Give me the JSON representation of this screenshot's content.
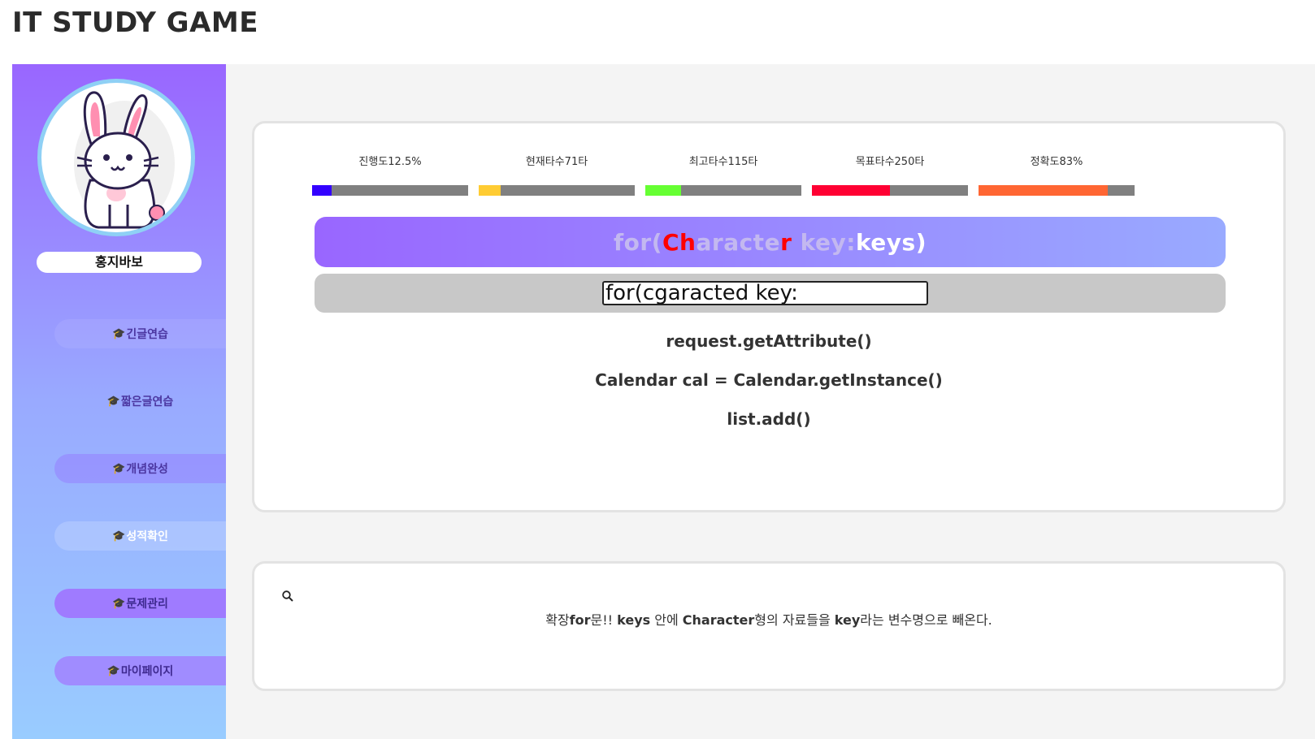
{
  "app": {
    "title": "IT STUDY GAME"
  },
  "user": {
    "name": "홍지바보"
  },
  "sidebar": {
    "icon": "graduation-cap-icon",
    "items": [
      {
        "label": "긴글연습"
      },
      {
        "label": "짧은글연습"
      },
      {
        "label": "개념완성"
      },
      {
        "label": "성적확인"
      },
      {
        "label": "문제관리"
      },
      {
        "label": "마이페이지"
      }
    ]
  },
  "stats": [
    {
      "label": "진행도12.5%",
      "fraction": 0.125,
      "color": "#3300ff"
    },
    {
      "label": "현재타수71타",
      "fraction": 0.142,
      "color": "#ffcc33"
    },
    {
      "label": "최고타수115타",
      "fraction": 0.23,
      "color": "#66ff33"
    },
    {
      "label": "목표타수250타",
      "fraction": 0.5,
      "color": "#ff0033"
    },
    {
      "label": "정확도83%",
      "fraction": 0.83,
      "color": "#ff6633"
    }
  ],
  "game": {
    "target": {
      "typed_1": "for(",
      "wrong_1": "Ch",
      "typed_2": "aracte",
      "wrong_2": "r",
      "typed_3": " key:",
      "rest": "keys)"
    },
    "input_value": "for(cgaracted key:",
    "next_lines": [
      "request.getAttribute()",
      "Calendar cal = Calendar.getInstance()",
      "list.add()"
    ]
  },
  "hint": {
    "icon": "search-icon",
    "text_1": "확장",
    "text_2": "for",
    "text_3": "문!! ",
    "text_4": "keys",
    "text_5": " 안에 ",
    "text_6": "Character",
    "text_7": "형의 자료들을 ",
    "text_8": "key",
    "text_9": "라는 변수명으로 빼온다."
  }
}
